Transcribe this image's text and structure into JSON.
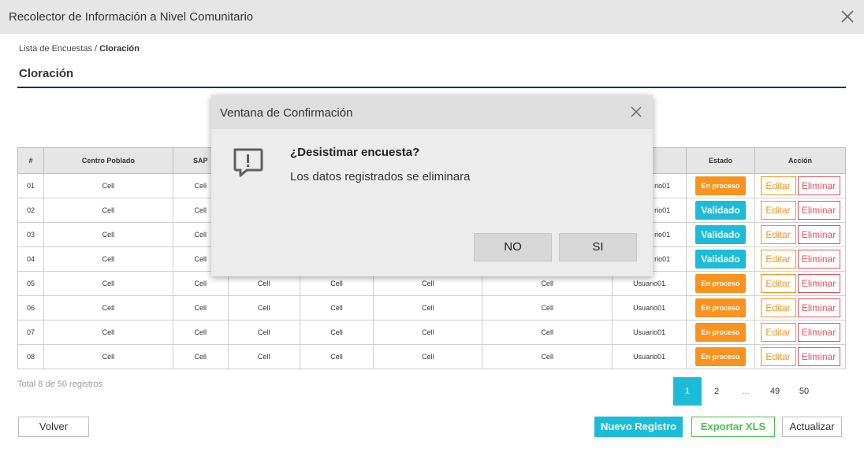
{
  "window": {
    "title": "Recolector de Información a Nivel Comunitario"
  },
  "breadcrumb": {
    "parent": "Lista de Encuestas",
    "separator": " / ",
    "current": "Cloración"
  },
  "page": {
    "title": "Cloración"
  },
  "table": {
    "headers": [
      "#",
      "Centro Poblado",
      "SAP",
      "",
      "",
      "",
      "",
      "rio",
      "Estado",
      "Acción"
    ],
    "rows": [
      {
        "num": "01",
        "centro": "Cell",
        "sap": "Cell",
        "c4": "",
        "c5": "",
        "c6": "",
        "c7": "",
        "usuario": "rio01",
        "estado": "En proceso",
        "estado_type": "proceso",
        "edit": "Editar",
        "delete": "Eliminar"
      },
      {
        "num": "02",
        "centro": "Cell",
        "sap": "Cell",
        "c4": "",
        "c5": "",
        "c6": "",
        "c7": "",
        "usuario": "rio01",
        "estado": "Validado",
        "estado_type": "validado",
        "edit": "Editar",
        "delete": "Eliminar"
      },
      {
        "num": "03",
        "centro": "Cell",
        "sap": "Cell",
        "c4": "",
        "c5": "",
        "c6": "",
        "c7": "",
        "usuario": "rio01",
        "estado": "Validado",
        "estado_type": "validado",
        "edit": "Editar",
        "delete": "Eliminar"
      },
      {
        "num": "04",
        "centro": "Cell",
        "sap": "Cell",
        "c4": "",
        "c5": "",
        "c6": "",
        "c7": "",
        "usuario": "rio01",
        "estado": "Validado",
        "estado_type": "validado",
        "edit": "Editar",
        "delete": "Eliminar"
      },
      {
        "num": "05",
        "centro": "Cell",
        "sap": "Cell",
        "c4": "Cell",
        "c5": "Cell",
        "c6": "Cell",
        "c7": "Cell",
        "usuario": "Usuario01",
        "estado": "En proceso",
        "estado_type": "proceso",
        "edit": "Editar",
        "delete": "Eliminar"
      },
      {
        "num": "06",
        "centro": "Cell",
        "sap": "Cell",
        "c4": "Cell",
        "c5": "Cell",
        "c6": "Cell",
        "c7": "Cell",
        "usuario": "Usuario01",
        "estado": "En proceso",
        "estado_type": "proceso",
        "edit": "Editar",
        "delete": "Eliminar"
      },
      {
        "num": "07",
        "centro": "Cell",
        "sap": "Cell",
        "c4": "Cell",
        "c5": "Cell",
        "c6": "Cell",
        "c7": "Cell",
        "usuario": "Usuario01",
        "estado": "En proceso",
        "estado_type": "proceso",
        "edit": "Editar",
        "delete": "Eliminar"
      },
      {
        "num": "08",
        "centro": "Cell",
        "sap": "Cell",
        "c4": "Cell",
        "c5": "Cell",
        "c6": "Cell",
        "c7": "Cell",
        "usuario": "Usuario01",
        "estado": "En proceso",
        "estado_type": "proceso",
        "edit": "Editar",
        "delete": "Eliminar"
      }
    ]
  },
  "footer": {
    "total": "Total 8 de 50 registros"
  },
  "pagination": {
    "p1": "1",
    "p2": "2",
    "ellipsis": "...",
    "p49": "49",
    "p50": "50",
    "active": "1"
  },
  "buttons": {
    "volver": "Volver",
    "nuevo": "Nuevo Registro",
    "exportar": "Exportar XLS",
    "actualizar": "Actualizar"
  },
  "modal": {
    "title": "Ventana de Confirmación",
    "heading": "¿Desistimar encuesta?",
    "message": "Los datos registrados se eliminara",
    "no": "NO",
    "si": "SI"
  },
  "colors": {
    "accent": "#1cbcd8",
    "proceso": "#f7931e",
    "edit": "#f7931e",
    "delete": "#e8505b",
    "export": "#4cc24c",
    "rule": "#1c2f6b"
  },
  "icons": {
    "window_close": "close-icon",
    "modal_close": "close-icon",
    "modal_icon": "comment-alert-icon"
  }
}
